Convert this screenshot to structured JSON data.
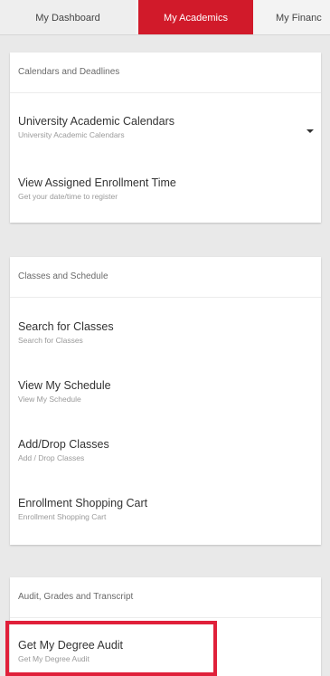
{
  "tabs": [
    {
      "label": "My Dashboard",
      "active": false
    },
    {
      "label": "My Academics",
      "active": true
    },
    {
      "label": "My Financ",
      "active": false
    }
  ],
  "calendars": {
    "header": "Calendars and Deadlines",
    "items": [
      {
        "title": "University Academic Calendars",
        "subtitle": "University Academic Calendars",
        "expandable": true
      },
      {
        "title": "View Assigned Enrollment Time",
        "subtitle": "Get your date/time to register"
      }
    ]
  },
  "classes": {
    "header": "Classes and Schedule",
    "items": [
      {
        "title": "Search for Classes",
        "subtitle": "Search for Classes"
      },
      {
        "title": "View My Schedule",
        "subtitle": "View My Schedule"
      },
      {
        "title": "Add/Drop Classes",
        "subtitle": "Add / Drop Classes"
      },
      {
        "title": "Enrollment Shopping Cart",
        "subtitle": "Enrollment Shopping Cart"
      }
    ]
  },
  "audit": {
    "header": "Audit, Grades and Transcript",
    "items": [
      {
        "title": "Get My Degree Audit",
        "subtitle": "Get My Degree Audit",
        "highlighted": true
      }
    ]
  },
  "colors": {
    "accent": "#d11a2a",
    "highlight_border": "#e0203a",
    "page_background": "#e9e9e9"
  },
  "icons": {
    "expand": "chevron-down-icon"
  }
}
